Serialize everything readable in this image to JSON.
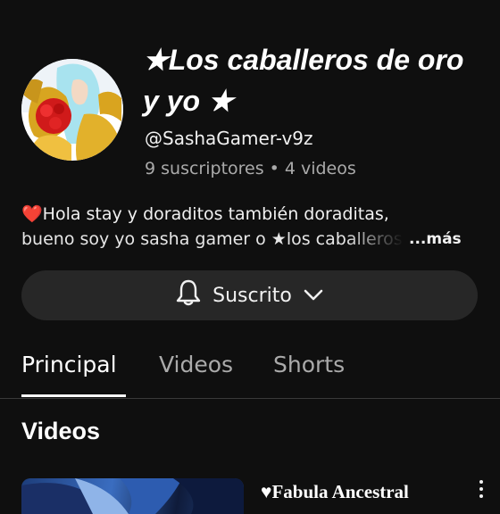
{
  "channel": {
    "title": "★Los caballeros de oro y yo ★",
    "handle": "@SashaGamer-v9z",
    "subscribers": "9 suscriptores",
    "separator": "•",
    "videos_count": "4 videos"
  },
  "description": {
    "line1": "❤️Hola stay y doraditos también doraditas,",
    "line2": "bueno soy yo sasha gamer o ★los caballeros",
    "more_label": "...más"
  },
  "subscribe_button": {
    "label": "Suscrito",
    "icon": "bell-icon"
  },
  "tabs": [
    {
      "label": "Principal",
      "active": true
    },
    {
      "label": "Videos",
      "active": false
    },
    {
      "label": "Shorts",
      "active": false
    }
  ],
  "section": {
    "title": "Videos"
  },
  "videos": [
    {
      "title": "♥Fabula Ancestral"
    }
  ],
  "colors": {
    "background": "#0f0f0f",
    "button_bg": "#272727",
    "secondary_text": "#aaaaaa"
  }
}
